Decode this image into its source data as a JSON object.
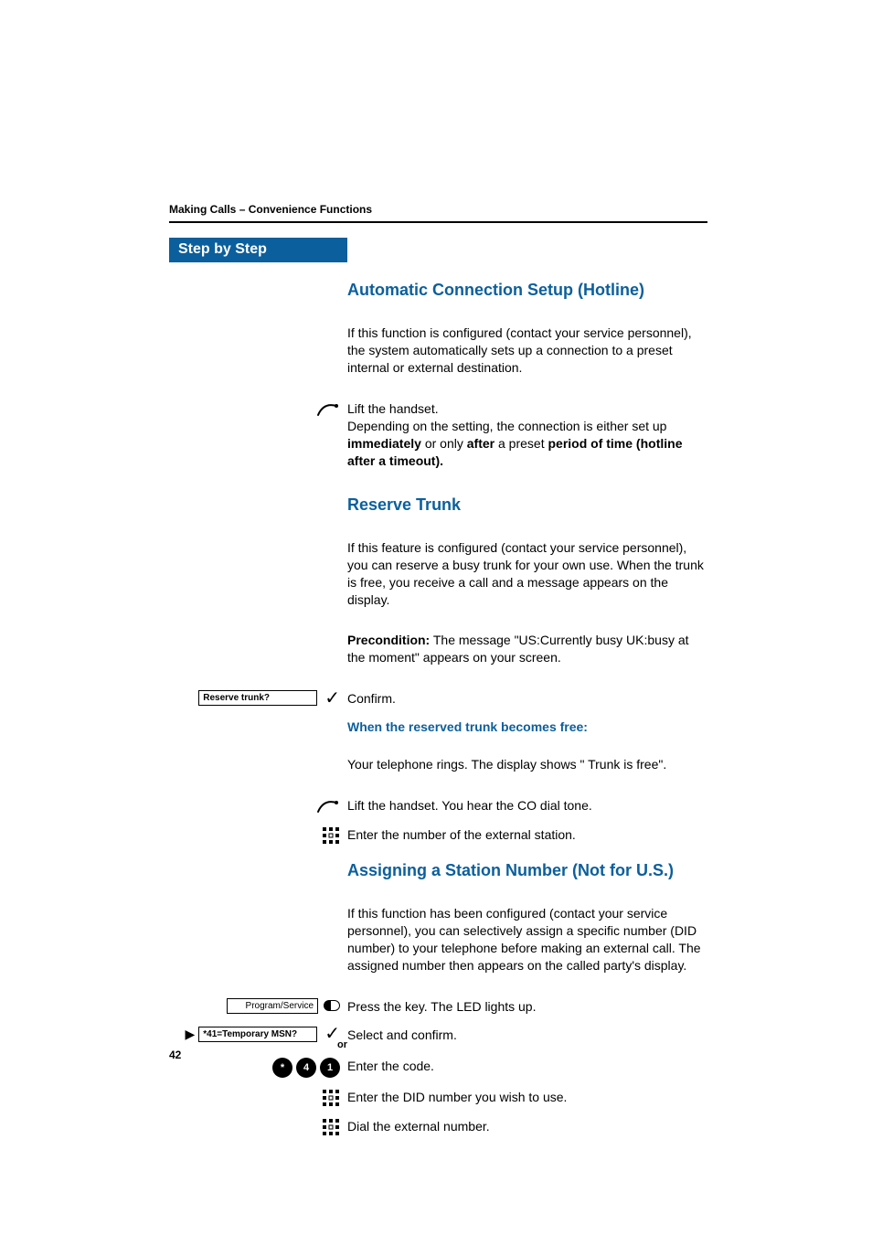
{
  "header": "Making Calls – Convenience Functions",
  "step_by_step": "Step by Step",
  "page_number": "42",
  "section_hotline": {
    "title": "Automatic Connection Setup (Hotline)",
    "intro": "If this function is configured (contact your service personnel), the system automatically sets up a connection to a preset internal or external destination.",
    "lift_handset_prefix": "Lift the handset.",
    "lift_handset_body1": "Depending on the setting, the connection is either set up ",
    "immediately": "immediately",
    "or_only": " or only ",
    "after_bold": "after",
    "preset_text": " a preset ",
    "period_bold": "period of time (hotline after a timeout)."
  },
  "section_reserve": {
    "title": "Reserve Trunk",
    "intro": "If this feature is configured (contact your service personnel), you can reserve a busy trunk for your own use. When the trunk is free, you receive a call and a message appears on the display.",
    "precondition_label": "Precondition:",
    "precondition_text": " The message \"US:Currently busy UK:busy at the moment\" appears on your screen.",
    "display_text": "Reserve trunk?",
    "confirm": "Confirm.",
    "sub_heading": "When the reserved trunk becomes free:",
    "ring_text": "Your telephone rings. The display shows \" Trunk is free\".",
    "lift_text": "Lift the handset. You hear the CO dial tone.",
    "enter_text": "Enter the number of the external station."
  },
  "section_assign": {
    "title": "Assigning a Station Number (Not for U.S.)",
    "intro": "If this function has been configured (contact your service personnel), you can selectively assign a specific number (DID number) to your telephone before making an external call. The assigned number then appears on the called party's display.",
    "key_label": "Program/Service",
    "press_key": "Press the key. The LED lights up.",
    "display_text": "*41=Temporary MSN?",
    "select_confirm": "Select and confirm.",
    "or_label": "or",
    "code_keys": [
      "*",
      "4",
      "1"
    ],
    "enter_code": "Enter the code.",
    "enter_did": "Enter the DID number you wish to use.",
    "dial_ext": "Dial the external number."
  }
}
